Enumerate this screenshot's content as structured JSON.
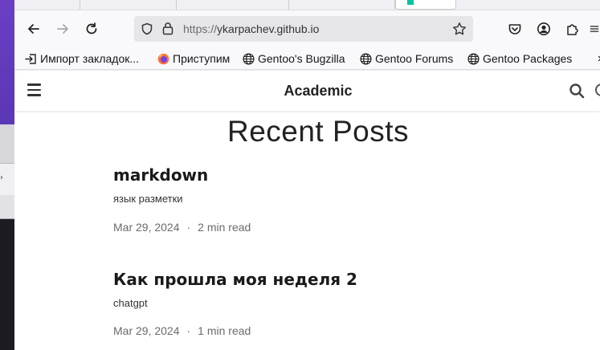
{
  "browser": {
    "url_protocol": "https://",
    "url_host": "ykarpachev.github.io",
    "bookmarks": [
      {
        "label": "Импорт закладок...",
        "icon": "import-icon"
      },
      {
        "label": "Приступим",
        "icon": "firefox-icon"
      },
      {
        "label": "Gentoo's Bugzilla",
        "icon": "globe-icon"
      },
      {
        "label": "Gentoo Forums",
        "icon": "globe-icon"
      },
      {
        "label": "Gentoo Packages",
        "icon": "globe-icon"
      }
    ],
    "overflow_label": "»"
  },
  "site": {
    "brand": "Academic",
    "page_title": "Recent Posts",
    "posts": [
      {
        "title": "markdown",
        "summary": "язык разметки",
        "date": "Mar 29, 2024",
        "read_time": "2 min read",
        "separator": "·"
      },
      {
        "title": "Как прошла моя неделя 2",
        "summary": "chatgpt",
        "date": "Mar 29, 2024",
        "read_time": "1 min read",
        "separator": "·"
      }
    ]
  },
  "colors": {
    "accent_tab": "#00c3a0",
    "desktop_purple": "#6a3fc4"
  }
}
